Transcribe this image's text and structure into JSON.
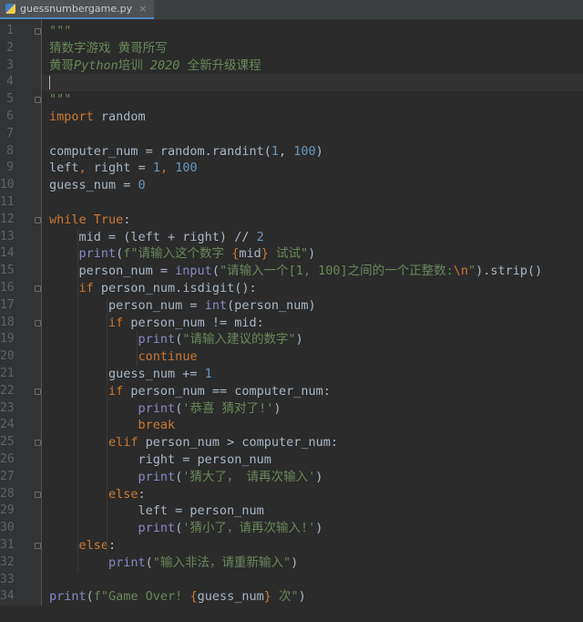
{
  "tab": {
    "filename": "guessnumbergame.py",
    "close_glyph": "×"
  },
  "icons": {
    "file": "python-file-icon",
    "close": "close-icon",
    "fold": "fold-marker-icon"
  },
  "colors": {
    "background": "#2b2b2b",
    "keyword": "#cc7832",
    "number": "#6897bb",
    "string": "#6a8759",
    "builtin": "#8888c6",
    "text": "#a9b7c6"
  },
  "lines": [
    [
      {
        "t": "\"\"\"",
        "c": "str"
      }
    ],
    [
      {
        "t": "猜数字游戏 黄哥所写",
        "c": "str"
      }
    ],
    [
      {
        "t": "黄哥",
        "c": "str"
      },
      {
        "t": "Python",
        "c": "str ital"
      },
      {
        "t": "培训 ",
        "c": "str"
      },
      {
        "t": "2020",
        "c": "str ital"
      },
      {
        "t": " 全新升级课程",
        "c": "str"
      }
    ],
    [],
    [
      {
        "t": "\"\"\"",
        "c": "str"
      }
    ],
    [
      {
        "t": "import",
        "c": "kw"
      },
      {
        "t": " random"
      }
    ],
    [],
    [
      {
        "t": "computer_num = random.randint("
      },
      {
        "t": "1",
        "c": "num"
      },
      {
        "t": ", "
      },
      {
        "t": "100",
        "c": "num"
      },
      {
        "t": ")"
      }
    ],
    [
      {
        "t": "left"
      },
      {
        "t": ",",
        "c": "kw"
      },
      {
        "t": " right = "
      },
      {
        "t": "1",
        "c": "num"
      },
      {
        "t": ",",
        "c": "kw"
      },
      {
        "t": " "
      },
      {
        "t": "100",
        "c": "num"
      }
    ],
    [
      {
        "t": "guess_num = "
      },
      {
        "t": "0",
        "c": "num"
      }
    ],
    [],
    [
      {
        "t": "while",
        "c": "kw"
      },
      {
        "t": " "
      },
      {
        "t": "True",
        "c": "kw"
      },
      {
        "t": ":"
      }
    ],
    [
      {
        "t": "    mid = (left + right) // "
      },
      {
        "t": "2",
        "c": "num"
      }
    ],
    [
      {
        "t": "    "
      },
      {
        "t": "print",
        "c": "bi"
      },
      {
        "t": "("
      },
      {
        "t": "f\"请输入这个数字 ",
        "c": "str"
      },
      {
        "t": "{",
        "c": "esc"
      },
      {
        "t": "mid"
      },
      {
        "t": "}",
        "c": "esc"
      },
      {
        "t": " 试试\"",
        "c": "str"
      },
      {
        "t": ")"
      }
    ],
    [
      {
        "t": "    person_num = "
      },
      {
        "t": "input",
        "c": "bi"
      },
      {
        "t": "("
      },
      {
        "t": "\"请输入一个[1, 100]之间的一个正整数:",
        "c": "str"
      },
      {
        "t": "\\n",
        "c": "esc"
      },
      {
        "t": "\"",
        "c": "str"
      },
      {
        "t": ").strip()"
      }
    ],
    [
      {
        "t": "    "
      },
      {
        "t": "if",
        "c": "kw"
      },
      {
        "t": " person_num.isdigit():"
      }
    ],
    [
      {
        "t": "        person_num = "
      },
      {
        "t": "int",
        "c": "bi"
      },
      {
        "t": "(person_num)"
      }
    ],
    [
      {
        "t": "        "
      },
      {
        "t": "if",
        "c": "kw"
      },
      {
        "t": " person_num != mid:"
      }
    ],
    [
      {
        "t": "            "
      },
      {
        "t": "print",
        "c": "bi"
      },
      {
        "t": "("
      },
      {
        "t": "\"请输入建议的数字\"",
        "c": "str"
      },
      {
        "t": ")"
      }
    ],
    [
      {
        "t": "            "
      },
      {
        "t": "continue",
        "c": "kw"
      }
    ],
    [
      {
        "t": "        guess_num += "
      },
      {
        "t": "1",
        "c": "num"
      }
    ],
    [
      {
        "t": "        "
      },
      {
        "t": "if",
        "c": "kw"
      },
      {
        "t": " person_num == computer_num:"
      }
    ],
    [
      {
        "t": "            "
      },
      {
        "t": "print",
        "c": "bi"
      },
      {
        "t": "("
      },
      {
        "t": "'恭喜 猜对了!'",
        "c": "str"
      },
      {
        "t": ")"
      }
    ],
    [
      {
        "t": "            "
      },
      {
        "t": "break",
        "c": "kw"
      }
    ],
    [
      {
        "t": "        "
      },
      {
        "t": "elif",
        "c": "kw"
      },
      {
        "t": " person_num > computer_num:"
      }
    ],
    [
      {
        "t": "            right = person_num"
      }
    ],
    [
      {
        "t": "            "
      },
      {
        "t": "print",
        "c": "bi"
      },
      {
        "t": "("
      },
      {
        "t": "'猜大了， 请再次输入'",
        "c": "str"
      },
      {
        "t": ")"
      }
    ],
    [
      {
        "t": "        "
      },
      {
        "t": "else",
        "c": "kw"
      },
      {
        "t": ":"
      }
    ],
    [
      {
        "t": "            left = person_num"
      }
    ],
    [
      {
        "t": "            "
      },
      {
        "t": "print",
        "c": "bi"
      },
      {
        "t": "("
      },
      {
        "t": "'猜小了，请再次输入!'",
        "c": "str"
      },
      {
        "t": ")"
      }
    ],
    [
      {
        "t": "    "
      },
      {
        "t": "else",
        "c": "kw"
      },
      {
        "t": ":"
      }
    ],
    [
      {
        "t": "        "
      },
      {
        "t": "print",
        "c": "bi"
      },
      {
        "t": "("
      },
      {
        "t": "\"输入非法，请重新输入\"",
        "c": "str"
      },
      {
        "t": ")"
      }
    ],
    [],
    [
      {
        "t": "print",
        "c": "bi"
      },
      {
        "t": "("
      },
      {
        "t": "f\"Game Over! ",
        "c": "str"
      },
      {
        "t": "{",
        "c": "esc"
      },
      {
        "t": "guess_num"
      },
      {
        "t": "}",
        "c": "esc"
      },
      {
        "t": " 次\"",
        "c": "str"
      },
      {
        "t": ")"
      }
    ]
  ]
}
